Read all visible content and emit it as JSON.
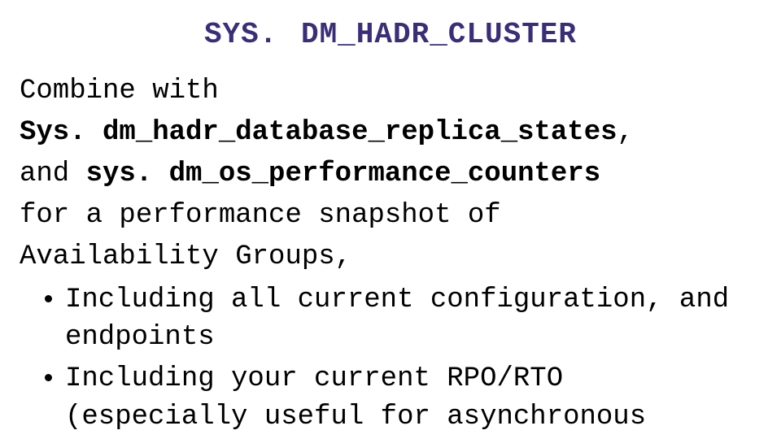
{
  "slide": {
    "title": "SYS. DM_HADR_CLUSTER",
    "line1_plain": "Combine with",
    "line2_bold": "Sys. dm_hadr_database_replica_states",
    "line2_tail": ",",
    "line3_plain_lead": "and ",
    "line3_bold": "sys. dm_os_performance_counters",
    "line4": "for a performance snapshot of",
    "line5": "Availability Groups,",
    "bullets": {
      "b1": "Including all current configuration, and endpoints",
      "b2": "Including your current RPO/RTO (especially useful for asynchronous"
    }
  }
}
